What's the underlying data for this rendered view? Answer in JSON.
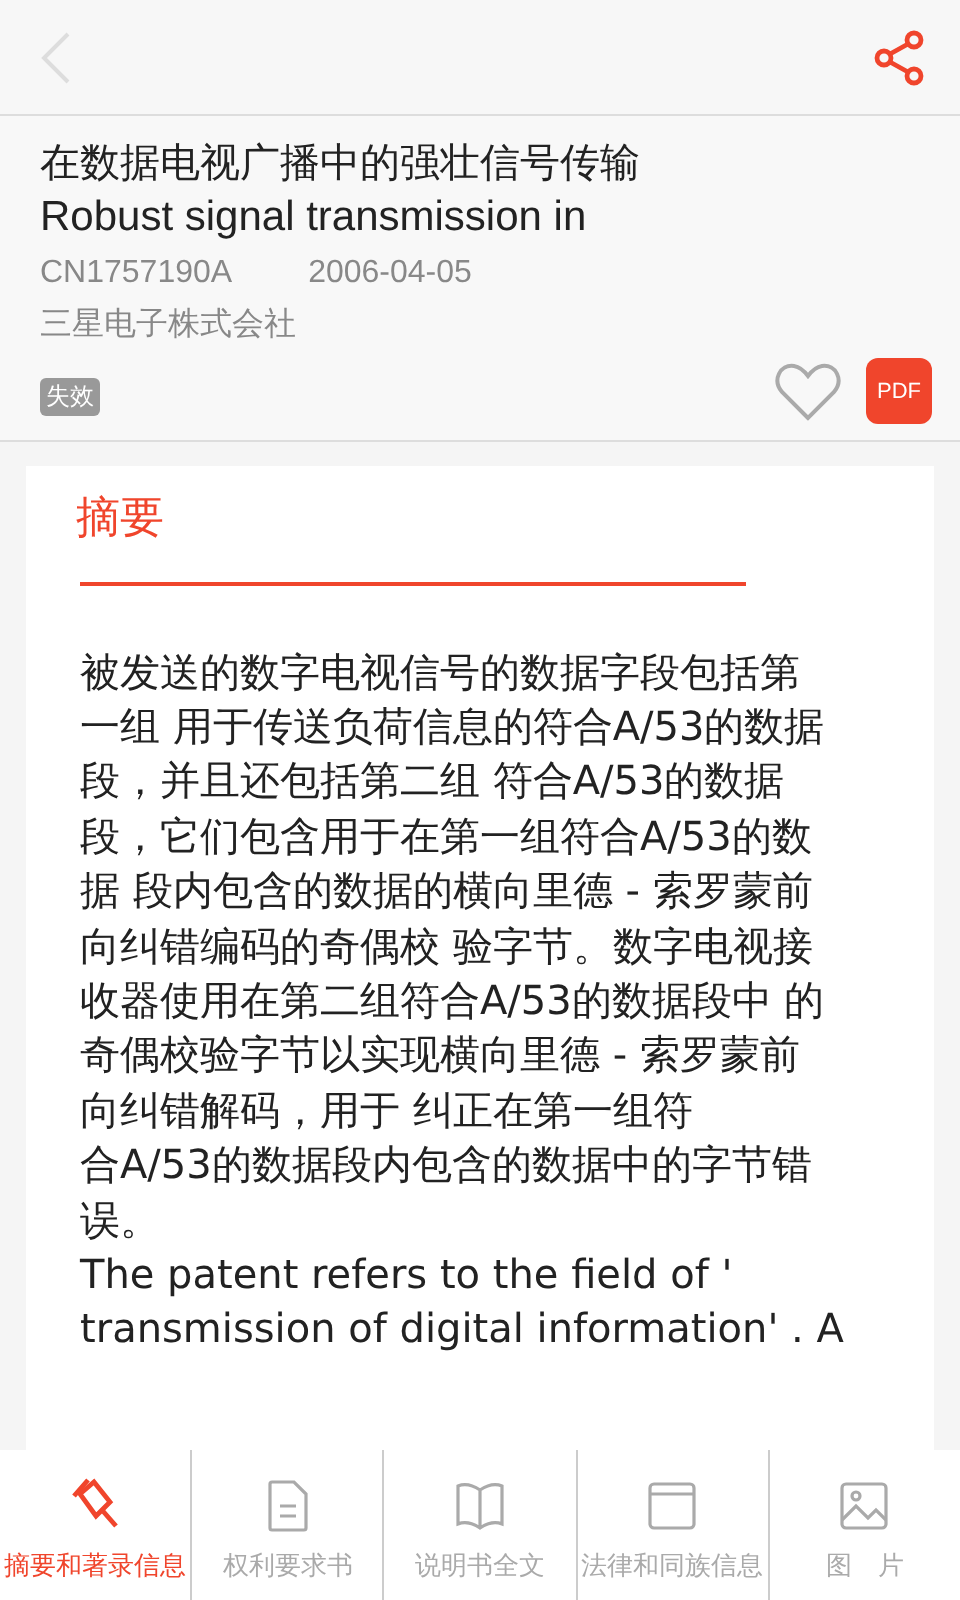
{
  "title_zh": "在数据电视广播中的强壮信号传输",
  "title_en": "Robust signal transmission in",
  "number": "CN1757190A",
  "date": "2006-04-05",
  "applicant": "三星电子株式会社",
  "status_badge": "失效",
  "pdf_button": "PDF",
  "section_title": "摘要",
  "abstract_lines": [
    "被发送的数字电视信号的数据字段包括第",
    "一组 用于传送负荷信息的符合A/53的数据",
    "段，并且还包括第二组 符合A/53的数据",
    "段，它们包含用于在第一组符合A/53的数",
    "据 段内包含的数据的横向里德 - 索罗蒙前",
    "向纠错编码的奇偶校 验字节。数字电视接",
    "收器使用在第二组符合A/53的数据段中 的",
    "奇偶校验字节以实现横向里德 - 索罗蒙前",
    "向纠错解码，用于 纠正在第一组符",
    "合A/53的数据段内包含的数据中的字节错",
    "误。",
    "The patent refers to the field of '",
    "transmission of digital information' . A"
  ],
  "nav": [
    {
      "label": "摘要和著录信息",
      "selected": true
    },
    {
      "label": "权利要求书",
      "selected": false
    },
    {
      "label": "说明书全文",
      "selected": false
    },
    {
      "label": "法律和同族信息",
      "selected": false
    },
    {
      "label": "图　片",
      "selected": false
    }
  ]
}
